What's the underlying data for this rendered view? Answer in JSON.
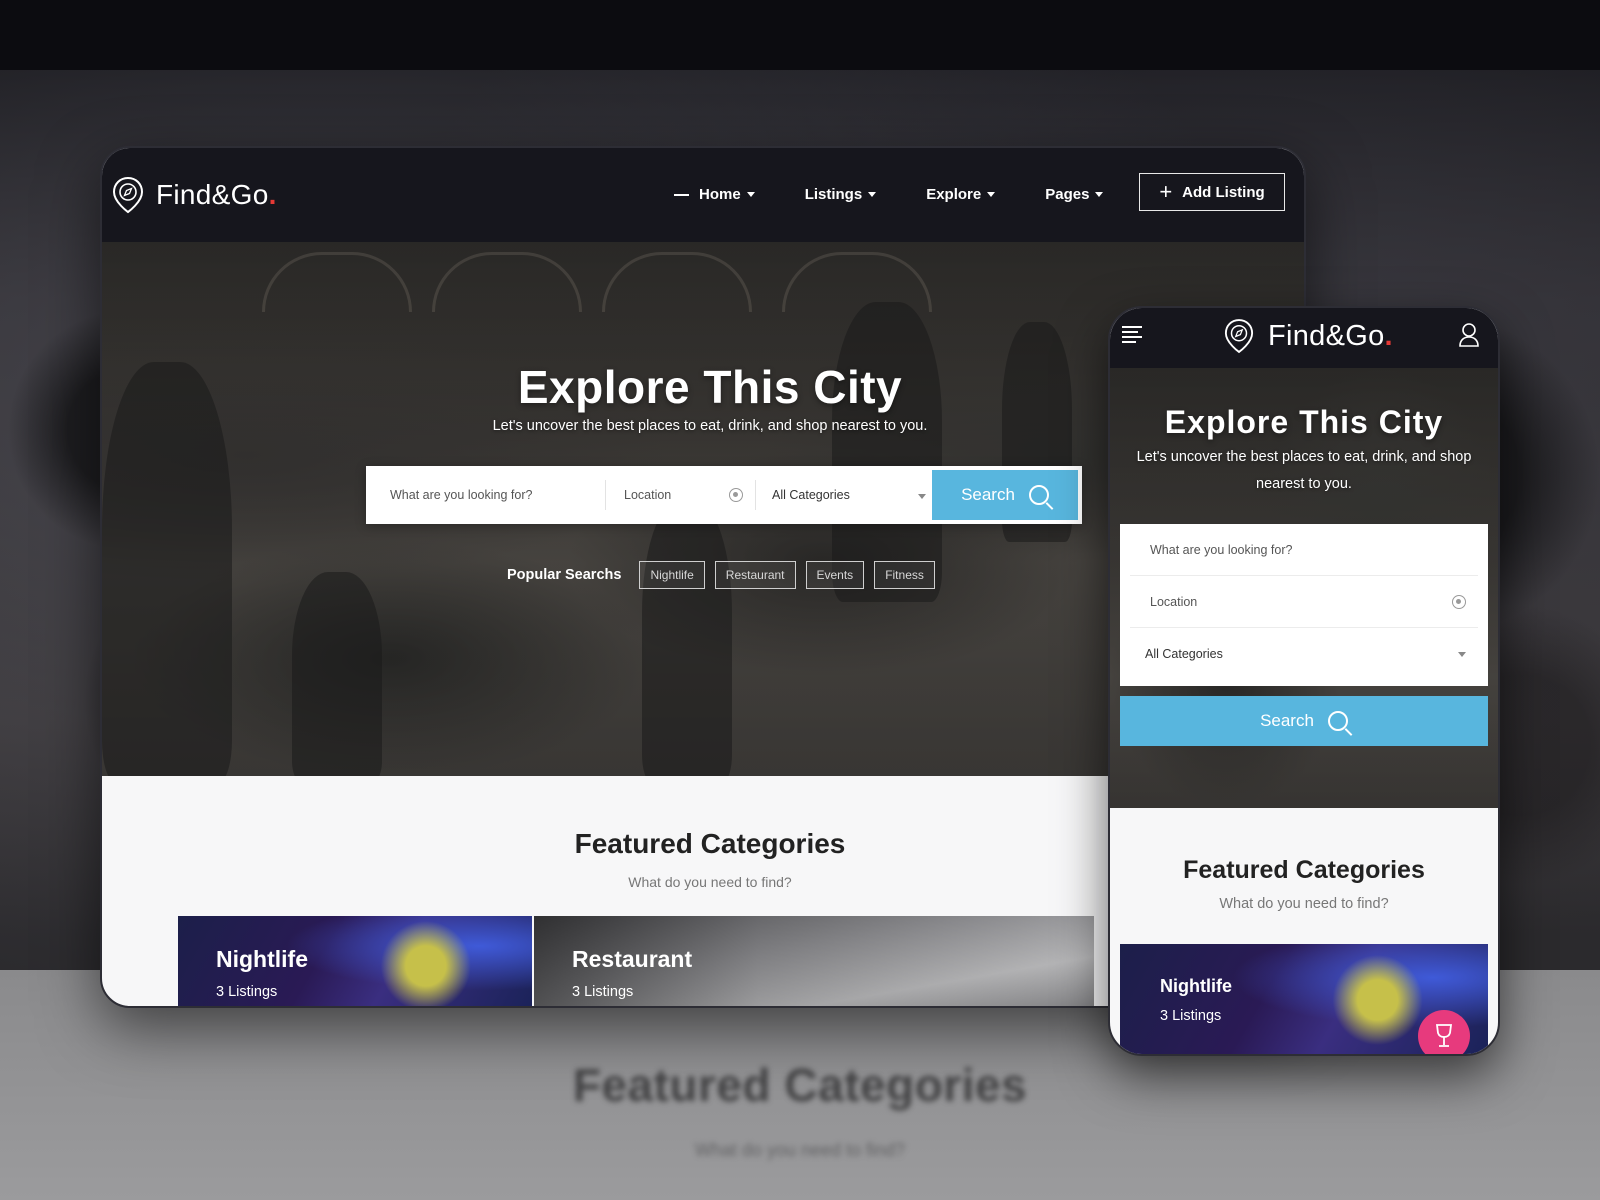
{
  "brand": {
    "name": "Find&Go",
    "dot": ".",
    "accent": "#e53935"
  },
  "colors": {
    "header_bg": "#16161d",
    "search_button": "#58b6de",
    "badge_pink": "#e73a7d"
  },
  "desktop": {
    "nav": {
      "items": [
        {
          "label": "Home"
        },
        {
          "label": "Listings"
        },
        {
          "label": "Explore"
        },
        {
          "label": "Pages"
        }
      ],
      "add_listing_label": "Add Listing"
    },
    "hero": {
      "title": "Explore This City",
      "subtitle": "Let's uncover the best places to eat, drink, and shop nearest to you."
    },
    "search": {
      "what_placeholder": "What are you looking for?",
      "location_placeholder": "Location",
      "category_selected": "All Categories",
      "button_label": "Search"
    },
    "popular": {
      "label": "Popular Searchs",
      "tags": [
        "Nightlife",
        "Restaurant",
        "Events",
        "Fitness"
      ]
    },
    "featured": {
      "title": "Featured Categories",
      "subtitle": "What do you need to find?",
      "cards": [
        {
          "title": "Nightlife",
          "count": "3 Listings"
        },
        {
          "title": "Restaurant",
          "count": "3 Listings"
        }
      ]
    }
  },
  "mobile": {
    "hero": {
      "title": "Explore This City",
      "subtitle": "Let's uncover the best places to eat, drink, and shop nearest to you."
    },
    "search": {
      "what_placeholder": "What are you looking for?",
      "location_placeholder": "Location",
      "category_selected": "All Categories",
      "button_label": "Search"
    },
    "featured": {
      "title": "Featured Categories",
      "subtitle": "What do you need to find?",
      "card": {
        "title": "Nightlife",
        "count": "3 Listings"
      }
    }
  },
  "backdrop": {
    "ghost_title": "Featured Categories",
    "ghost_subtitle": "What do you need to find?"
  },
  "icons": [
    "map-pin-compass-icon",
    "chevron-down-icon",
    "plus-icon",
    "search-icon",
    "location-target-icon",
    "hamburger-menu-icon",
    "user-icon",
    "wine-glass-icon"
  ]
}
